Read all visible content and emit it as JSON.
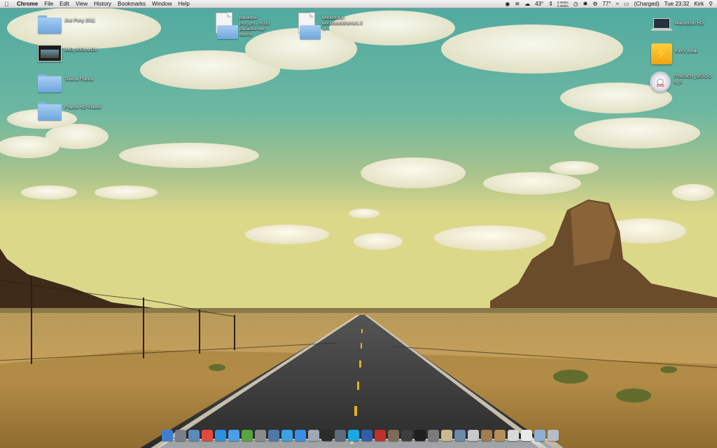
{
  "menubar": {
    "app": "Chrome",
    "menus": [
      "File",
      "Edit",
      "View",
      "History",
      "Bookmarks",
      "Window",
      "Help"
    ],
    "status": {
      "temp_weather": "43°",
      "net_up": "0.2KB/s",
      "net_down": "0.4KB/s",
      "temp_sensor": "77°",
      "battery": "(Charged)",
      "clock": "Tue 23:32",
      "user": "Kirk"
    }
  },
  "desktop_left": [
    {
      "label": "Jive Pony 2011",
      "kind": "folder"
    },
    {
      "label": "IMG_3059.MOV",
      "kind": "movie"
    },
    {
      "label": "Terena France",
      "kind": "folder"
    },
    {
      "label": "France HD Videos",
      "kind": "folder"
    }
  ],
  "desktop_top": [
    {
      "label": "paradise-pro_gm...m.zip paradise-wp-theme",
      "kind": "docfile"
    },
    {
      "label": "woodstock-woodstocktheme1.0.4",
      "kind": "docfile"
    }
  ],
  "desktop_right": [
    {
      "label": "Macintosh HD",
      "kind": "laptop"
    },
    {
      "label": "Kirk's Book",
      "kind": "drive"
    },
    {
      "label": "FRASIER_SEASON_5",
      "kind": "dvd",
      "badge": "DVD"
    }
  ],
  "dock": {
    "items": [
      {
        "name": "finder",
        "color": "#3e7fd6"
      },
      {
        "name": "rocket",
        "color": "#7a7f8a"
      },
      {
        "name": "preview",
        "color": "#5a8ab8"
      },
      {
        "name": "chrome",
        "color": "#e24b3b"
      },
      {
        "name": "safari",
        "color": "#2f8fe0"
      },
      {
        "name": "itunes",
        "color": "#4aa0e8"
      },
      {
        "name": "spotify",
        "color": "#56a540"
      },
      {
        "name": "photo-booth",
        "color": "#8b8b8b"
      },
      {
        "name": "iphoto",
        "color": "#4d79a8"
      },
      {
        "name": "twitter",
        "color": "#3aa1e6"
      },
      {
        "name": "app-store",
        "color": "#3a8ee6"
      },
      {
        "name": "mail",
        "color": "#a0a8b4"
      },
      {
        "name": "dashboard",
        "color": "#2b2b2b"
      },
      {
        "name": "camera",
        "color": "#5e6b7b"
      },
      {
        "name": "skype",
        "color": "#1aa7e6"
      },
      {
        "name": "word",
        "color": "#2f5faa"
      },
      {
        "name": "red-app",
        "color": "#c0302a"
      },
      {
        "name": "photos-app",
        "color": "#7d6b58"
      },
      {
        "name": "activity-monitor",
        "color": "#3d3d3d"
      },
      {
        "name": "terminal",
        "color": "#1f1f1f"
      },
      {
        "name": "automator",
        "color": "#7a7a7a"
      },
      {
        "name": "books",
        "color": "#c9b98f"
      },
      {
        "name": "applications-stack",
        "color": "#6c88aa"
      },
      {
        "name": "documents-stack",
        "color": "#c8c8c8"
      },
      {
        "name": "downloads-stack",
        "color": "#a47b4e"
      },
      {
        "name": "box-stack",
        "color": "#b58e5a"
      },
      {
        "name": "mail-stack",
        "color": "#d9d9d9"
      },
      {
        "name": "at-stack",
        "color": "#e9e9e9"
      },
      {
        "name": "folder-stack",
        "color": "#8fb0d4"
      },
      {
        "name": "trash",
        "color": "#b6bcc4"
      }
    ]
  }
}
